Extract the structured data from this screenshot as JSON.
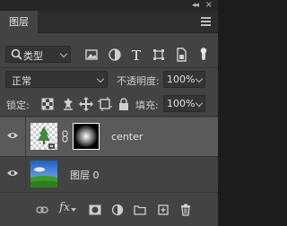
{
  "window": {
    "collapse_glyph": "◂◂",
    "close_glyph": "×"
  },
  "tabs": [
    {
      "label": "图层"
    }
  ],
  "filter": {
    "selected": "类型"
  },
  "blend": {
    "mode": "正常",
    "opacity_label": "不透明度:",
    "opacity_value": "100%"
  },
  "lock": {
    "label": "锁定:",
    "fill_label": "填充:",
    "fill_value": "100%"
  },
  "layers": [
    {
      "name": "center",
      "visible": true,
      "selected": true,
      "has_mask": true
    },
    {
      "name": "图层 0",
      "visible": true,
      "selected": false,
      "has_mask": false
    }
  ],
  "icons": {
    "filter_bar": [
      "search-icon",
      "image-filter-icon",
      "adjustment-filter-icon",
      "type-filter-icon",
      "shape-filter-icon",
      "smart-object-filter-icon",
      "filter-toggle-icon"
    ],
    "lock_bar": [
      "lock-transparent-icon",
      "lock-image-icon",
      "lock-position-icon",
      "lock-artboard-icon",
      "lock-all-icon"
    ],
    "bottom_bar": [
      "link-icon",
      "fx-icon",
      "mask-icon",
      "adjustment-icon",
      "group-icon",
      "new-layer-icon",
      "delete-icon"
    ]
  },
  "bottom": {
    "fx_label": "fx"
  },
  "colors": {
    "panel": "#434343",
    "selected_row": "#5a5a5a",
    "tab_bar": "#2d2d2d"
  }
}
